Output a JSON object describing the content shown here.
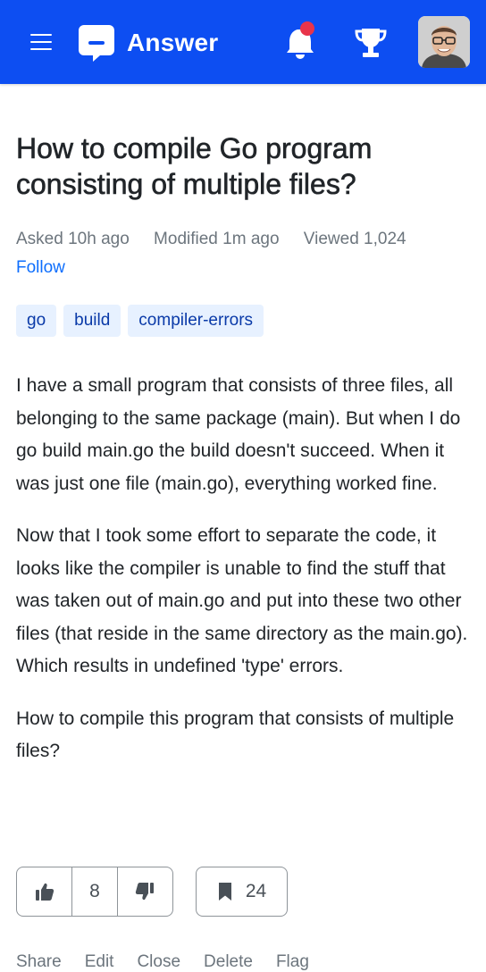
{
  "header": {
    "brand": "Answer",
    "colors": {
      "bar": "#0d4ef2",
      "notification_dot": "#e8344a"
    },
    "icons": [
      "menu-icon",
      "logo-icon",
      "bell-icon",
      "trophy-icon",
      "avatar"
    ]
  },
  "question": {
    "title": "How to compile Go program consisting of multiple files?",
    "asked": "Asked 10h ago",
    "modified": "Modified 1m ago",
    "viewed": "Viewed 1,024",
    "follow_label": "Follow",
    "tags": [
      "go",
      "build",
      "compiler-errors"
    ],
    "paragraphs": [
      "I have a small program that consists of three files, all belonging to the same package (main). But when I do go build main.go the build doesn't succeed. When it was just one file (main.go), everything worked fine.",
      "Now that I took some effort to separate the code, it looks like the compiler is unable to find the stuff that was taken out of main.go and put into these two other files (that reside in the same directory as the main.go). Which results in undefined 'type' errors.",
      "How to compile this program that consists of multiple files?"
    ],
    "votes": "8",
    "bookmarks": "24",
    "actions": [
      "Share",
      "Edit",
      "Close",
      "Delete",
      "Flag"
    ]
  }
}
